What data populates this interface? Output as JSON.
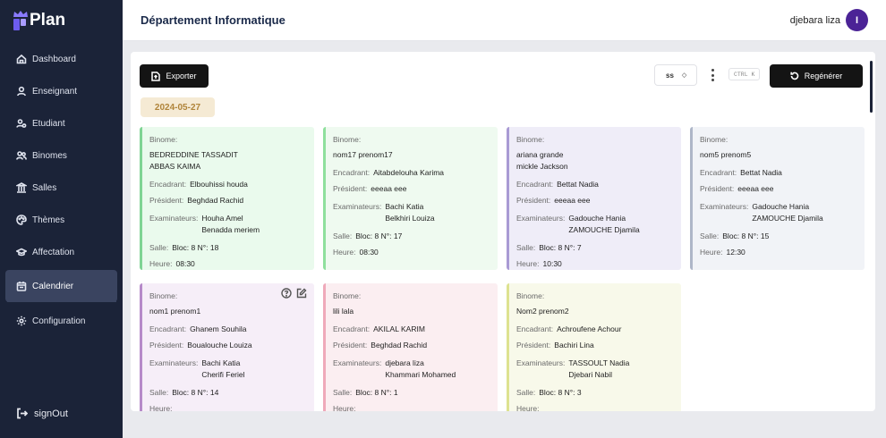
{
  "app": {
    "logo_text": "Plan"
  },
  "sidebar": {
    "items": [
      {
        "label": "Dashboard",
        "icon": "home-icon"
      },
      {
        "label": "Enseignant",
        "icon": "user-icon"
      },
      {
        "label": "Etudiant",
        "icon": "users-icon"
      },
      {
        "label": "Binomes",
        "icon": "people-icon"
      },
      {
        "label": "Salles",
        "icon": "building-icon"
      },
      {
        "label": "Thèmes",
        "icon": "palette-icon"
      },
      {
        "label": "Affectation",
        "icon": "graduation-cap-icon"
      },
      {
        "label": "Calendrier",
        "icon": "calendar-icon",
        "active": true
      }
    ],
    "config_label": "Configuration",
    "signout_label": "signOut"
  },
  "header": {
    "title": "Département Informatique",
    "user_name": "djebara liza",
    "avatar_letter": "I",
    "avatar_color": "#4b2396"
  },
  "toolbar": {
    "export_label": "Exporter",
    "select_value": "ss",
    "shortcut": "CTRL K",
    "regen_label": "Regénérer"
  },
  "date": "2024-05-27",
  "labels": {
    "binome": "Binome:",
    "encadrant": "Encadrant:",
    "president": "Président:",
    "examinateurs": "Examinateurs:",
    "salle": "Salle:",
    "heure": "Heure:"
  },
  "cards": [
    {
      "binome": [
        "BEDREDDINE TASSADIT",
        "ABBAS KAIMA"
      ],
      "encadrant": "Elbouhissi houda",
      "president": "Beghdad Rachid",
      "examinateurs": [
        "Houha Amel",
        "Benadda meriem"
      ],
      "salle": "Bloc: 8 N°: 18",
      "heure": "08:30"
    },
    {
      "binome": [
        "nom17 prenom17"
      ],
      "encadrant": "Aitabdelouha Karima",
      "president": "eeeaa eee",
      "examinateurs": [
        "Bachi Katia",
        "Belkhiri Louiza"
      ],
      "salle": "Bloc: 8 N°: 17",
      "heure": "08:30"
    },
    {
      "binome": [
        "ariana grande",
        "mickle Jackson"
      ],
      "encadrant": "Bettat Nadia",
      "president": "eeeaa eee",
      "examinateurs": [
        "Gadouche Hania",
        "ZAMOUCHE Djamila"
      ],
      "salle": "Bloc: 8 N°: 7",
      "heure": "10:30"
    },
    {
      "binome": [
        "nom5 prenom5"
      ],
      "encadrant": "Bettat Nadia",
      "president": "eeeaa eee",
      "examinateurs": [
        "Gadouche Hania",
        "ZAMOUCHE Djamila"
      ],
      "salle": "Bloc: 8 N°: 15",
      "heure": "12:30"
    },
    {
      "binome": [
        "nom1 prenom1"
      ],
      "encadrant": "Ghanem Souhila",
      "president": "Boualouche Louiza",
      "examinateurs": [
        "Bachi Katia",
        "Cherifi Feriel"
      ],
      "salle": "Bloc: 8 N°: 14",
      "heure": ""
    },
    {
      "binome": [
        "lili lala"
      ],
      "encadrant": "AKILAL KARIM",
      "president": "Beghdad Rachid",
      "examinateurs": [
        "djebara liza",
        "Khammari Mohamed"
      ],
      "salle": "Bloc: 8 N°: 1",
      "heure": ""
    },
    {
      "binome": [
        "Nom2 prenom2"
      ],
      "encadrant": "Achroufene Achour",
      "president": "Bachiri Lina",
      "examinateurs": [
        "TASSOULT Nadia",
        "Djebari Nabil"
      ],
      "salle": "Bloc: 8 N°: 3",
      "heure": ""
    }
  ]
}
